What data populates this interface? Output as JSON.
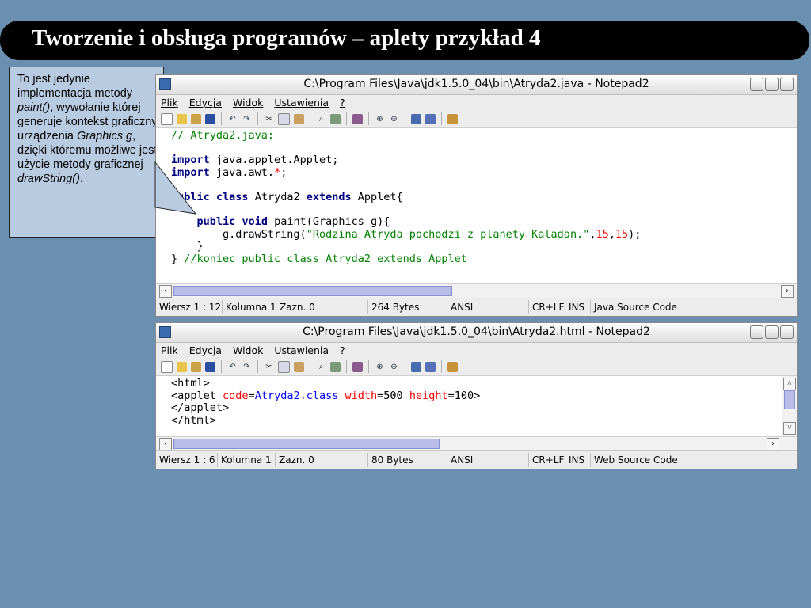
{
  "slide": {
    "title": "Tworzenie i obsługa programów – aplety przykład 4"
  },
  "callout": {
    "t1": "To jest jedynie implementacja metody ",
    "t2": "paint()",
    "t3": ", wywołanie której generuje kontekst graficzny urządzenia ",
    "t4": "Graphics g",
    "t5": ", dzięki któremu możliwe jest użycie metody graficznej ",
    "t6": "drawString()",
    "t7": "."
  },
  "menu": {
    "file": "Plik",
    "edit": "Edycja",
    "view": "Widok",
    "settings": "Ustawienia",
    "help": "?"
  },
  "window1": {
    "title": "C:\\Program Files\\Java\\jdk1.5.0_04\\bin\\Atryda2.java - Notepad2",
    "code": {
      "l1": "// Atryda2.java:",
      "l3_kw": "import",
      "l3_rest": " java.applet.Applet;",
      "l4_kw": "import",
      "l4_rest": " java.awt.",
      "l4_star": "*",
      "l4_end": ";",
      "l6_kw1": "public",
      "l6_kw2": "class",
      "l6_name": " Atryda2 ",
      "l6_kw3": "extends",
      "l6_rest": " Applet{",
      "l8_kw1": "public",
      "l8_kw2": "void",
      "l8_rest": " paint(Graphics g){",
      "l9_pre": "g.drawString(",
      "l9_str": "\"Rodzina Atryda pochodzi z planety Kaladan.\"",
      "l9_c1": ",",
      "l9_n1": "15",
      "l9_c2": ",",
      "l9_n2": "15",
      "l9_end": ");",
      "l10": "}",
      "l11_brace": "}",
      "l11_cm": " //koniec public class Atryda2 extends Applet"
    },
    "status": {
      "line": "Wiersz 1 : 12",
      "col": "Kolumna 1",
      "sel": "Zazn. 0",
      "size": "264 Bytes",
      "enc": "ANSI",
      "eol": "CR+LF",
      "mode": "INS",
      "lang": "Java Source Code"
    }
  },
  "window2": {
    "title": "C:\\Program Files\\Java\\jdk1.5.0_04\\bin\\Atryda2.html - Notepad2",
    "code": {
      "l1": "<html>",
      "l2_tag": "<applet ",
      "l2_a1": "code",
      "l2_eq1": "=",
      "l2_v1": "Atryda2.class",
      "l2_a2": "width",
      "l2_eq2": "=",
      "l2_v2": "500",
      "l2_a3": "height",
      "l2_eq3": "=",
      "l2_v3": "100",
      "l2_end": ">",
      "l3": "</applet>",
      "l4": "</html>"
    },
    "status": {
      "line": "Wiersz 1 : 6",
      "col": "Kolumna 1",
      "sel": "Zazn. 0",
      "size": "80 Bytes",
      "enc": "ANSI",
      "eol": "CR+LF",
      "mode": "INS",
      "lang": "Web Source Code"
    }
  }
}
